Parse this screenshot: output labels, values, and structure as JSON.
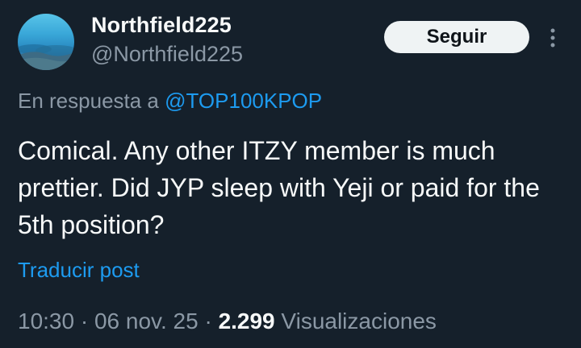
{
  "author": {
    "display_name": "Northfield225",
    "handle": "@Northfield225"
  },
  "follow_button": {
    "label": "Seguir"
  },
  "more_icon": "more-vertical-icon",
  "reply": {
    "prefix": "En respuesta a",
    "mention": "@TOP100KPOP"
  },
  "tweet": {
    "text": "Comical. Any other ITZY member is much prettier. Did JYP sleep with Yeji or paid for the 5th position?"
  },
  "translate_link": "Traducir post",
  "meta": {
    "time": "10:30",
    "sep1": "·",
    "date": "06 nov. 25",
    "sep2": "·",
    "views_count": "2.299",
    "views_label": "Visualizaciones"
  },
  "colors": {
    "background": "#15202b",
    "primary_text": "#f7f9f9",
    "secondary_text": "#8b98a5",
    "accent": "#1d9bf0",
    "button_bg": "#eff3f4"
  }
}
